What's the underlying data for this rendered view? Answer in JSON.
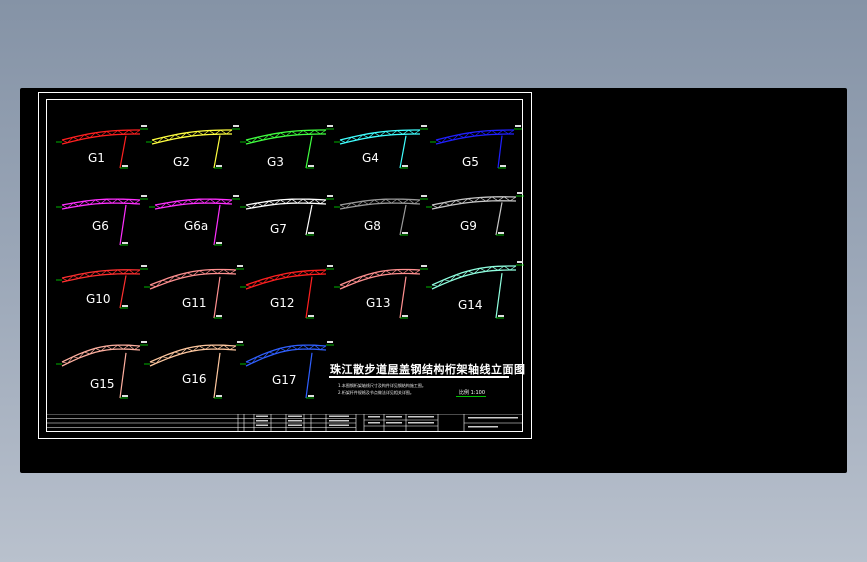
{
  "drawing": {
    "title": "珠江散步道屋盖钢结构桁架轴线立面图",
    "notes": [
      "1.本图钢桁架轴线尺寸及构件详见钢结构施工图。",
      "2.桁架杆件规格及节点做法详见相关详图。"
    ],
    "scale_label": "比例 1:100"
  },
  "trusses": [
    {
      "label": "G1",
      "color": "#ff2020"
    },
    {
      "label": "G2",
      "color": "#ffff40"
    },
    {
      "label": "G3",
      "color": "#40ff40"
    },
    {
      "label": "G4",
      "color": "#40ffff"
    },
    {
      "label": "G5",
      "color": "#2020ff"
    },
    {
      "label": "G6",
      "color": "#ff30ff"
    },
    {
      "label": "G6a",
      "color": "#ff30ff"
    },
    {
      "label": "G7",
      "color": "#ffffff"
    },
    {
      "label": "G8",
      "color": "#9a9a9a"
    },
    {
      "label": "G9",
      "color": "#c8c8c8"
    },
    {
      "label": "G10",
      "color": "#ff3030"
    },
    {
      "label": "G11",
      "color": "#ff9090"
    },
    {
      "label": "G12",
      "color": "#ff2020"
    },
    {
      "label": "G13",
      "color": "#ff9090"
    },
    {
      "label": "G14",
      "color": "#90ffe0"
    },
    {
      "label": "G15",
      "color": "#ffb0a0"
    },
    {
      "label": "G16",
      "color": "#ffc8a0"
    },
    {
      "label": "G17",
      "color": "#3060ff"
    }
  ]
}
